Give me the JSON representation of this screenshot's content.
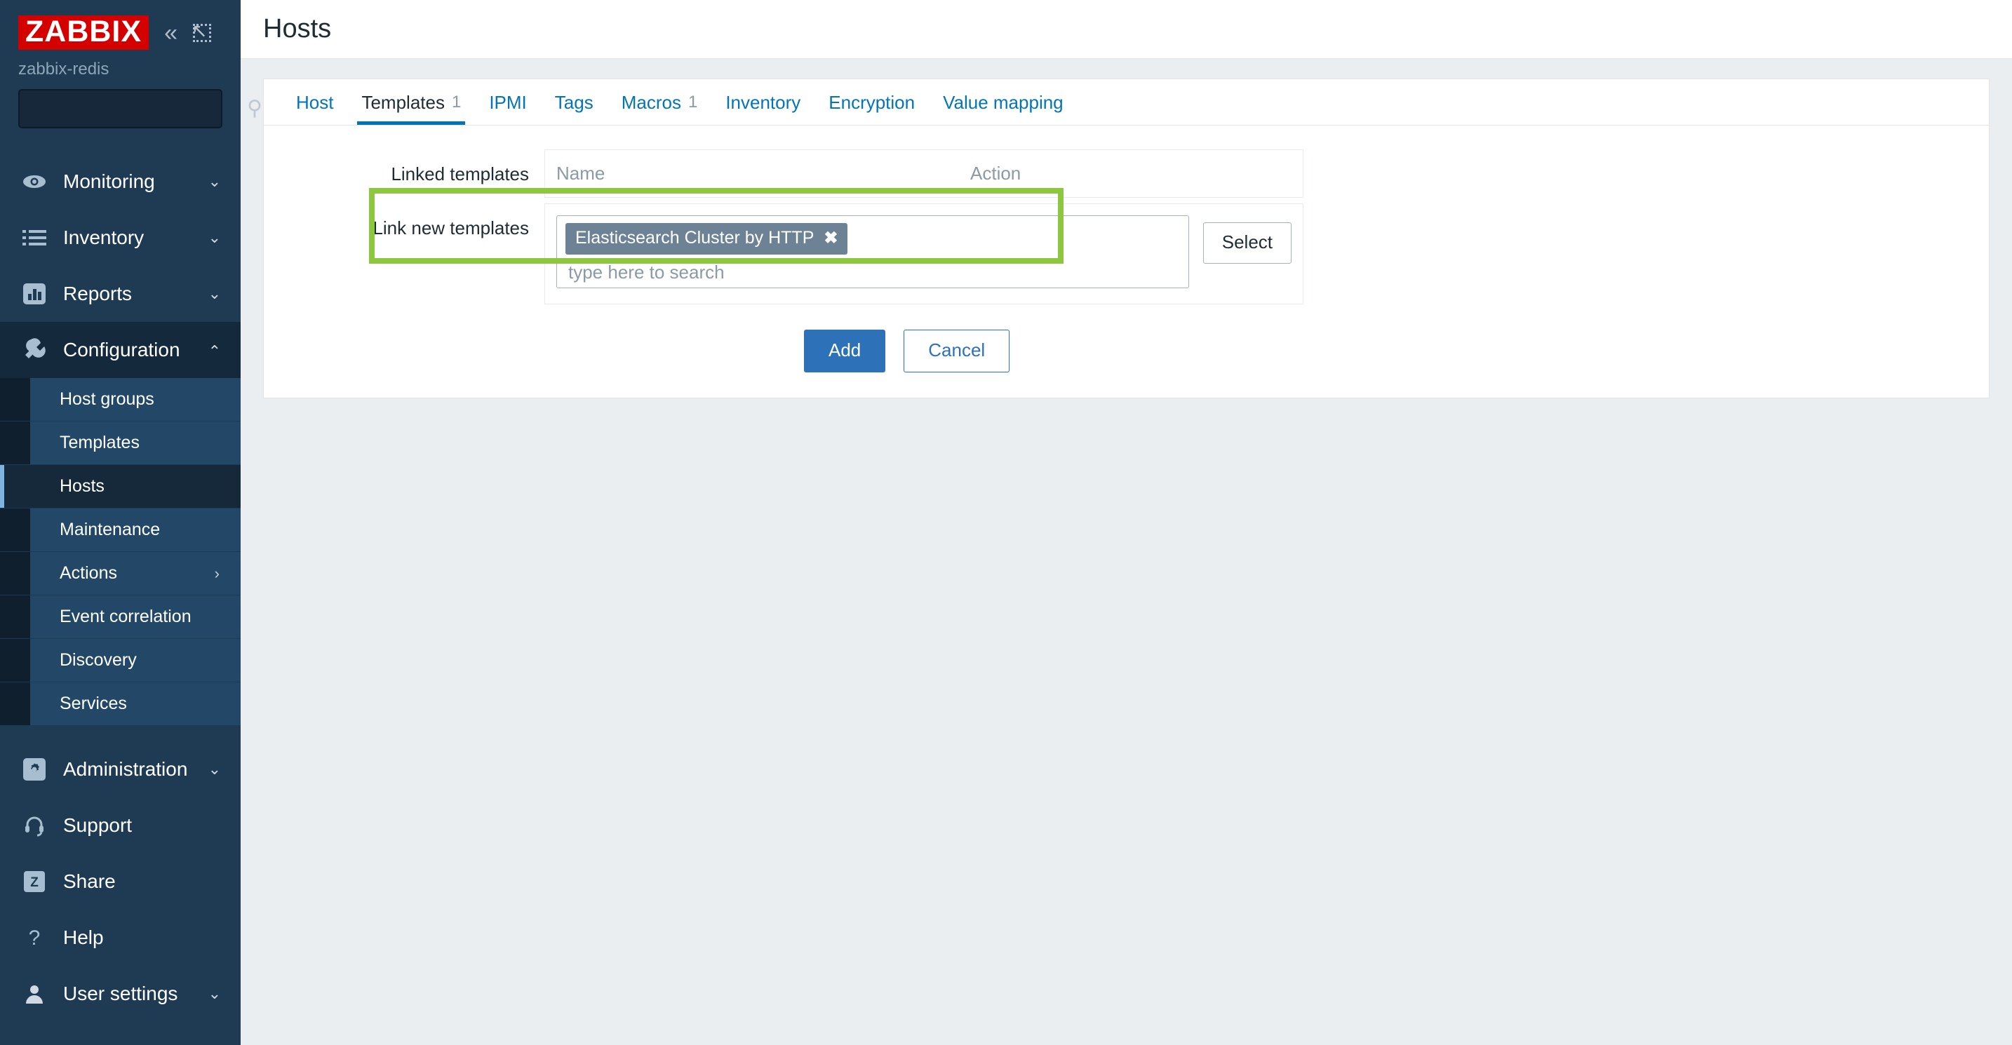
{
  "sidebar": {
    "logo_text": "ZABBIX",
    "server_name": "zabbix-redis",
    "collapse_icon": "double-chevron-left-icon",
    "expand_icon": "expand-arrow-icon",
    "search": {
      "value": "",
      "placeholder": ""
    },
    "nav": [
      {
        "label": "Monitoring",
        "icon": "eye-icon",
        "chevron": "down",
        "active": false
      },
      {
        "label": "Inventory",
        "icon": "list-icon",
        "chevron": "down",
        "active": false
      },
      {
        "label": "Reports",
        "icon": "bar-chart-icon",
        "chevron": "down",
        "active": false
      },
      {
        "label": "Configuration",
        "icon": "wrench-icon",
        "chevron": "up",
        "active": true
      }
    ],
    "submenu": [
      {
        "label": "Host groups",
        "selected": false,
        "arrow": ""
      },
      {
        "label": "Templates",
        "selected": false,
        "arrow": ""
      },
      {
        "label": "Hosts",
        "selected": true,
        "arrow": ""
      },
      {
        "label": "Maintenance",
        "selected": false,
        "arrow": ""
      },
      {
        "label": "Actions",
        "selected": false,
        "arrow": "›"
      },
      {
        "label": "Event correlation",
        "selected": false,
        "arrow": ""
      },
      {
        "label": "Discovery",
        "selected": false,
        "arrow": ""
      },
      {
        "label": "Services",
        "selected": false,
        "arrow": ""
      }
    ],
    "nav_bottom": [
      {
        "label": "Administration",
        "icon": "gear-icon",
        "chevron": "down"
      },
      {
        "label": "Support",
        "icon": "headset-icon",
        "chevron": ""
      },
      {
        "label": "Share",
        "icon": "zabbix-z-icon",
        "chevron": ""
      },
      {
        "label": "Help",
        "icon": "question-mark-icon",
        "chevron": ""
      },
      {
        "label": "User settings",
        "icon": "user-icon",
        "chevron": "down"
      }
    ]
  },
  "header": {
    "title": "Hosts"
  },
  "tabs": [
    {
      "label": "Host",
      "count": "",
      "active": false
    },
    {
      "label": "Templates",
      "count": "1",
      "active": true
    },
    {
      "label": "IPMI",
      "count": "",
      "active": false
    },
    {
      "label": "Tags",
      "count": "",
      "active": false
    },
    {
      "label": "Macros",
      "count": "1",
      "active": false
    },
    {
      "label": "Inventory",
      "count": "",
      "active": false
    },
    {
      "label": "Encryption",
      "count": "",
      "active": false
    },
    {
      "label": "Value mapping",
      "count": "",
      "active": false
    }
  ],
  "form": {
    "linked_templates": {
      "label": "Linked templates",
      "col_name": "Name",
      "col_action": "Action"
    },
    "link_new_templates": {
      "label": "Link new templates",
      "chip": "Elasticsearch Cluster by HTTP",
      "chip_remove": "✖",
      "placeholder": "type here to search",
      "select_label": "Select"
    },
    "buttons": {
      "add": "Add",
      "cancel": "Cancel"
    }
  },
  "colors": {
    "sidebar_bg": "#1f3b53",
    "logo_red": "#d40000",
    "accent_blue": "#0275b8",
    "highlight_green": "#8dc63f",
    "chip_bg": "#6d8294"
  }
}
